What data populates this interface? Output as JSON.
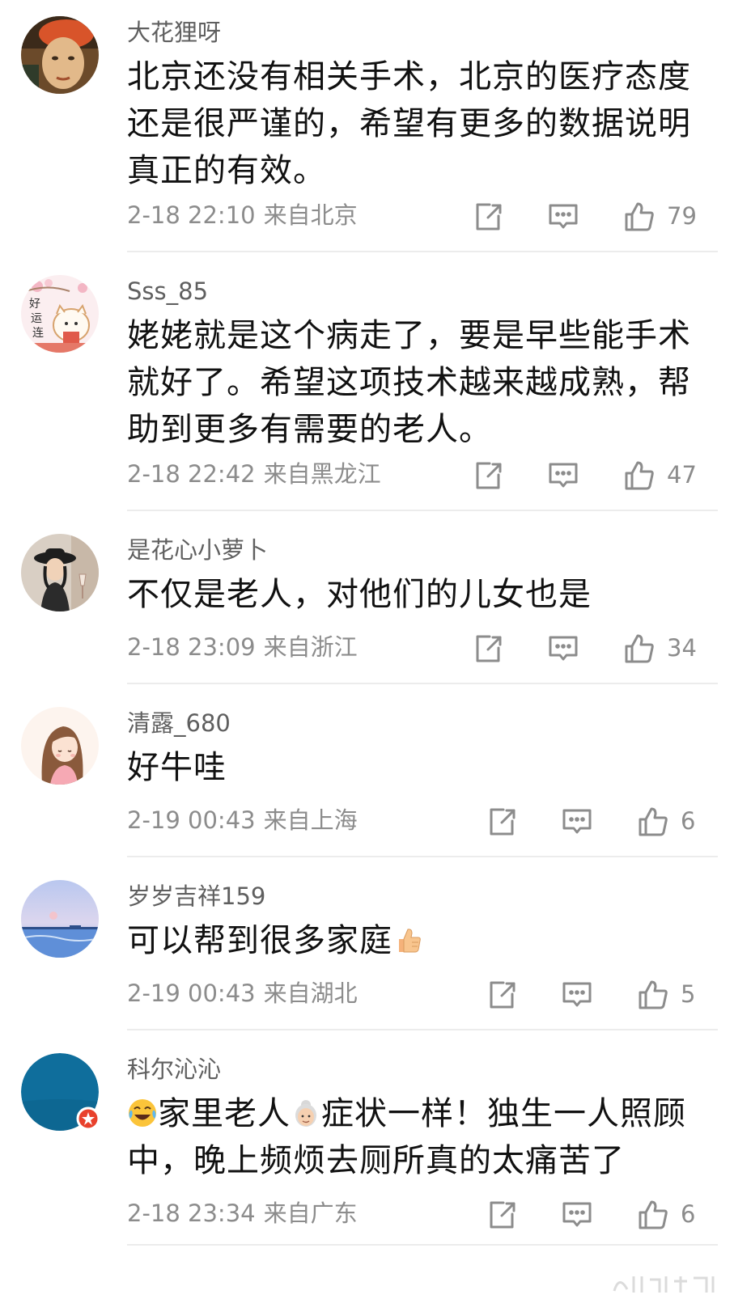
{
  "comments": [
    {
      "username": "大花狸呀",
      "text": "北京还没有相关手术，北京的医疗态度还是很严谨的，希望有更多的数据说明真正的有效。",
      "date": "2-18 22:10",
      "location": "来自北京",
      "likes": "79",
      "avatar_icon": "avatar-painted-portrait"
    },
    {
      "username": "Sss_85",
      "text": "姥姥就是这个病走了，要是早些能手术就好了。希望这项技术越来越成熟，帮助到更多有需要的老人。",
      "date": "2-18 22:42",
      "location": "来自黑龙江",
      "likes": "47",
      "avatar_icon": "avatar-cartoon-cat",
      "avatar_text": "好\n运\n连"
    },
    {
      "username": "是花心小萝卜",
      "text": "不仅是老人，对他们的儿女也是",
      "date": "2-18 23:09",
      "location": "来自浙江",
      "likes": "34",
      "avatar_icon": "avatar-woman-hat"
    },
    {
      "username": "清露_680",
      "text": "好牛哇",
      "date": "2-19 00:43",
      "location": "来自上海",
      "likes": "6",
      "avatar_icon": "avatar-cartoon-girl"
    },
    {
      "username": "岁岁吉祥159",
      "text": "可以帮到很多家庭",
      "text_suffix_emoji": "thumbs-up-emoji",
      "date": "2-19 00:43",
      "location": "来自湖北",
      "likes": "5",
      "avatar_icon": "avatar-sunset-sea"
    },
    {
      "username": "科尔沁沁",
      "text_prefix_emoji": "laugh-cry-emoji",
      "text_part1": "家里老人",
      "text_mid_emoji": "old-woman-emoji",
      "text_part2": "症状一样！独生一人照顾中，晚上频烦去厕所真的太痛苦了",
      "date": "2-18 23:34",
      "location": "来自广东",
      "likes": "6",
      "avatar_icon": "avatar-blue-circle",
      "badge_icon": "red-star-badge"
    }
  ],
  "icons": {
    "share": "share-icon",
    "reply": "comment-icon",
    "like": "thumbs-up-icon"
  },
  "colors": {
    "text": "#111111",
    "username": "#5f5f5f",
    "meta": "#8c8c8c",
    "divider": "#ececec",
    "badge": "#e8412c"
  }
}
